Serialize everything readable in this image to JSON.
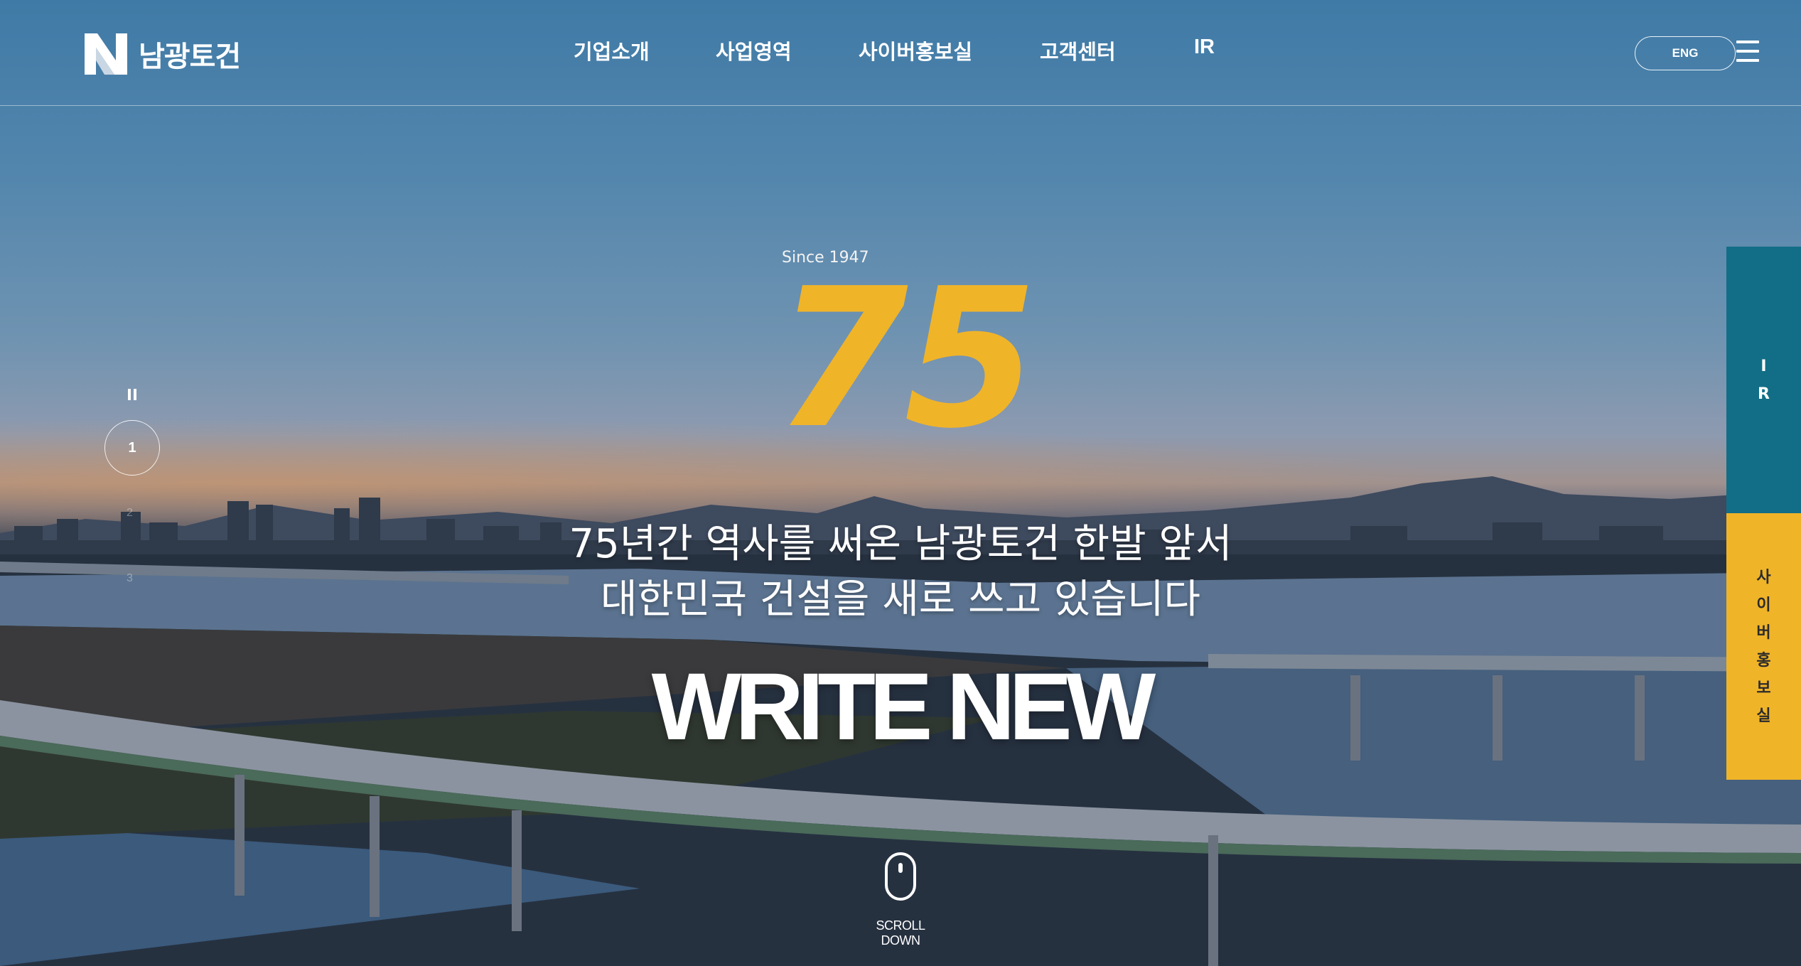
{
  "header": {
    "logo_text": "남광토건",
    "nav": [
      {
        "label": "기업소개"
      },
      {
        "label": "사업영역"
      },
      {
        "label": "사이버홍보실"
      },
      {
        "label": "고객센터"
      },
      {
        "label": "IR"
      }
    ],
    "lang_button": "ENG",
    "menu_icon": "hamburger-menu-icon"
  },
  "hero": {
    "since": "Since 1947",
    "years": "75",
    "tagline_line1": "75년간 역사를 써온 남광토건 한발 앞서",
    "tagline_line2": "대한민국 건설을 새로 쓰고 있습니다",
    "headline": "WRITE NEW",
    "scroll_label": "SCROLL DOWN"
  },
  "slider": {
    "current_page": "1",
    "next_pages": [
      "2",
      "3"
    ],
    "pause_icon": "pause-icon"
  },
  "side_tabs": {
    "ir": [
      "I",
      "R"
    ],
    "cyber": [
      "사",
      "이",
      "버",
      "홍",
      "보",
      "실"
    ]
  },
  "colors": {
    "accent_yellow": "#f0b429",
    "ir_teal": "#126e87"
  }
}
